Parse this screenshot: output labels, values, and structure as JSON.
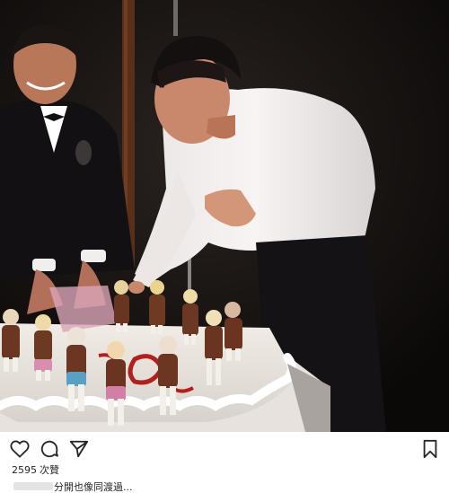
{
  "post": {
    "likes_count": "2595",
    "likes_label": "次贊",
    "caption_text": "分開也像同渡過..."
  },
  "icons": {
    "like": "heart-icon",
    "comment": "comment-bubble-icon",
    "share": "paper-plane-icon",
    "save": "bookmark-icon"
  },
  "colors": {
    "text": "#262626",
    "background": "#ffffff",
    "icon_stroke": "#262626"
  }
}
